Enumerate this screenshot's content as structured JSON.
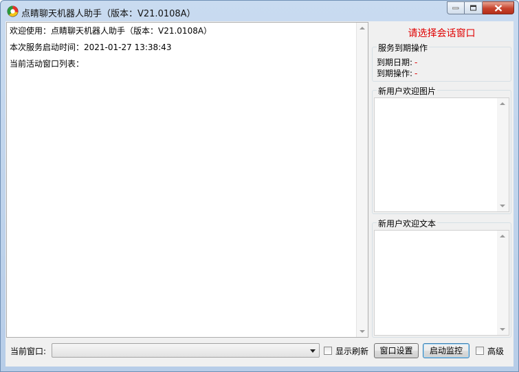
{
  "window": {
    "title": "点睛聊天机器人助手（版本：V21.0108A）"
  },
  "log": {
    "lines": [
      "欢迎使用：点睛聊天机器人助手（版本：V21.0108A）",
      "本次服务启动时间：2021-01-27 13:38:43",
      "当前活动窗口列表："
    ]
  },
  "right_panel": {
    "session_prompt": "请选择会话窗口",
    "service_group": {
      "legend": "服务到期操作",
      "expire_date_label": "到期日期:",
      "expire_date_value": "-",
      "expire_action_label": "到期操作:",
      "expire_action_value": "-"
    },
    "welcome_image_group": {
      "legend": "新用户欢迎图片"
    },
    "welcome_text_group": {
      "legend": "新用户欢迎文本"
    }
  },
  "bottom": {
    "current_window_label": "当前窗口:",
    "current_window_value": "",
    "show_refresh_label": "显示刷新",
    "show_refresh_checked": false,
    "window_settings_label": "窗口设置",
    "start_monitor_label": "启动监控",
    "advanced_label": "高级",
    "advanced_checked": false
  },
  "colors": {
    "accent_red": "#e00000",
    "title_bar": "#c9dbf0"
  }
}
